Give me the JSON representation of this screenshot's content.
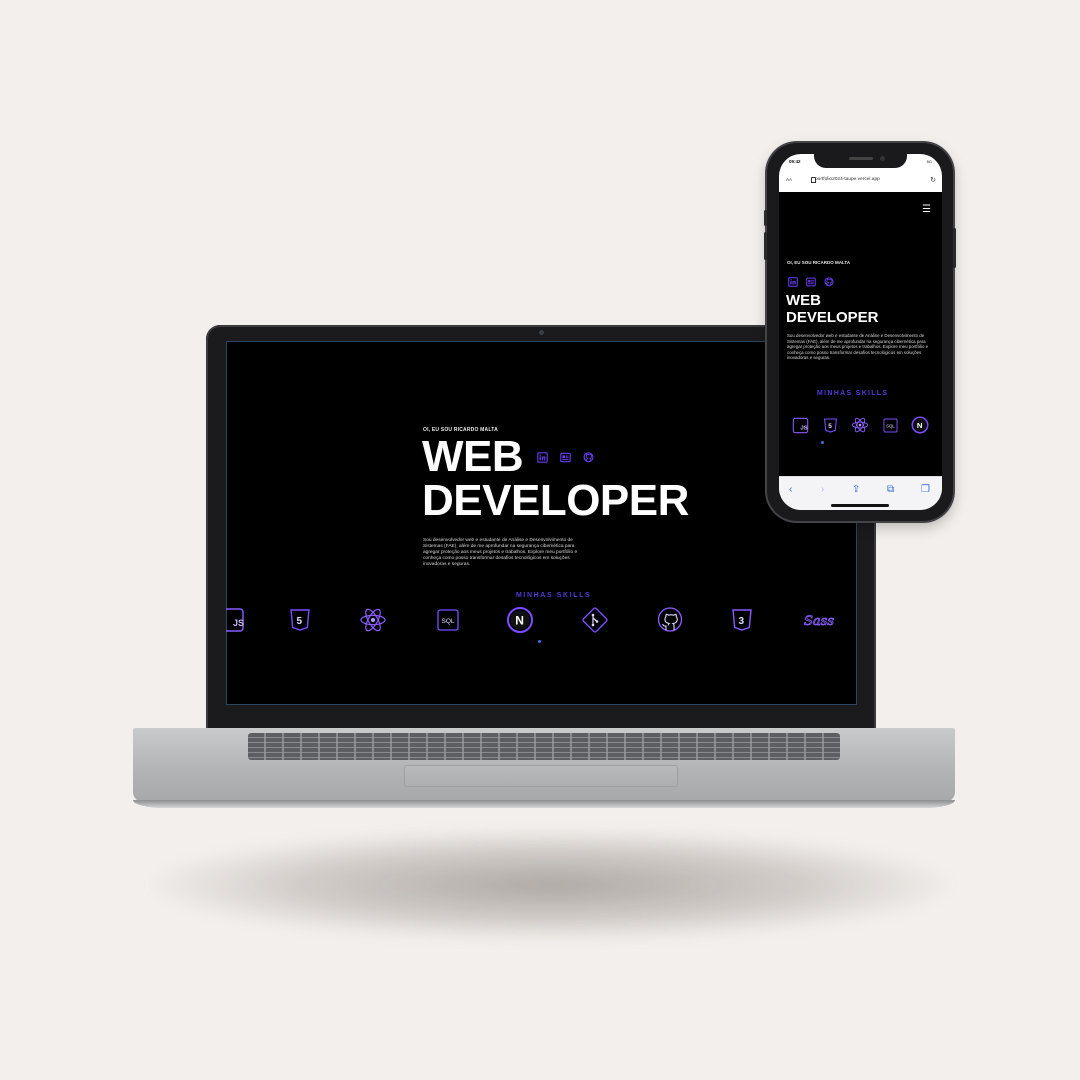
{
  "site": {
    "greeting": "OI, EU SOU RICARDO MALTA",
    "title_line1": "WEB",
    "title_line2": "DEVELOPER",
    "description": "Sou desenvolvedor web e estudante de Análise e Desenvolvimento de Sistemas (FAE), além de me aprofundar na segurança cibernética para agregar proteção aos meus projetos e trabalhos. Explore meu portfólio e conheça como posso transformar desafios tecnológicos em soluções inovadoras e seguras.",
    "skills_title": "MINHAS SKILLS",
    "social_icons": [
      "linkedin-icon",
      "resume-icon",
      "github-icon"
    ],
    "laptop_skills": [
      {
        "icon": "javascript-icon",
        "label": "JS"
      },
      {
        "icon": "html5-icon",
        "label": "5"
      },
      {
        "icon": "react-icon",
        "label": ""
      },
      {
        "icon": "sql-icon",
        "label": "SQL"
      },
      {
        "icon": "nextjs-icon",
        "label": "N"
      },
      {
        "icon": "git-icon",
        "label": ""
      },
      {
        "icon": "github-icon",
        "label": ""
      },
      {
        "icon": "css3-icon",
        "label": "3"
      },
      {
        "icon": "sass-icon",
        "label": "Sass"
      }
    ],
    "phone_skills": [
      {
        "icon": "javascript-icon",
        "label": "JS"
      },
      {
        "icon": "html5-icon",
        "label": "5"
      },
      {
        "icon": "react-icon",
        "label": ""
      },
      {
        "icon": "sql-icon",
        "label": "SQL"
      },
      {
        "icon": "nextjs-icon",
        "label": "N"
      }
    ],
    "accent_color": "#6a3df0",
    "skills_title_color": "#4c39d6"
  },
  "phone": {
    "status_time": "09:42",
    "status_right": "5G",
    "url_aa": "AA",
    "url": "portfolio2024-taupe.vercel.app",
    "reload_glyph": "↻",
    "menu_glyph": "☰",
    "toolbar": [
      {
        "icon": "back-icon",
        "glyph": "‹"
      },
      {
        "icon": "forward-icon",
        "glyph": "›"
      },
      {
        "icon": "share-icon",
        "glyph": "⇪"
      },
      {
        "icon": "bookmarks-icon",
        "glyph": "⧉"
      },
      {
        "icon": "tabs-icon",
        "glyph": "❐"
      }
    ]
  }
}
